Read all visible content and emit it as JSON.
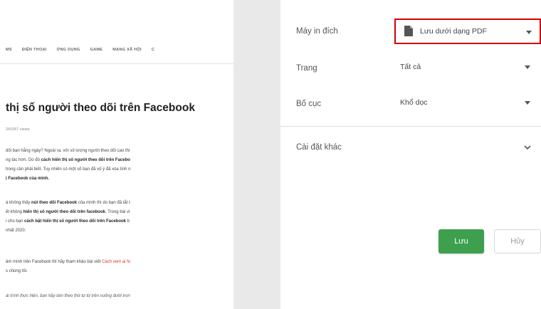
{
  "preview": {
    "nav": [
      "MS",
      "ĐIỆN THOẠI",
      "ỨNG DỤNG",
      "GAME",
      "MẠNG XÃ HỘI",
      "C"
    ],
    "title": "thị số người theo dõi trên Facebook",
    "views": "241067 views",
    "p1": [
      "dõi bạn hằng ngày? Ngoài ra, với số lượng người theo dõi cao thì",
      [
        "ng tác hơn. Do đó ",
        "cách hiển thị số người theo dõi trên Facebo"
      ],
      "trong cần phải biết. Tuy nhiên có một số bạn đã vô ý đã xóa tính n",
      "ị Facebook của mình."
    ],
    "p2": [
      [
        "à không thấy ",
        "nút theo dõi Facebook",
        " của mình thì do bạn đã tắt t"
      ],
      [
        "ết không ",
        "hiển thị số người theo dõi trên facebook",
        ". Trong bài vi"
      ],
      [
        "i cho bạn ",
        "cách bật hiển thị số người theo dõi trên Facebook",
        " b"
      ],
      "nhất 2020."
    ],
    "p3": [
      [
        "âm mình trên Facebook thì hãy tham khảo bài viết ",
        "Cách xem ai fo"
      ],
      "s chúng tôi."
    ],
    "p4": "ái trình thực hiện, bạn hãy làm theo thứ tự từ trên xuống dưới tron"
  },
  "panel": {
    "dest_label": "Máy in đích",
    "dest_value": "Lưu dưới dạng PDF",
    "pages_label": "Trang",
    "pages_value": "Tất cả",
    "layout_label": "Bố cục",
    "layout_value": "Khổ dọc",
    "more_label": "Cài đặt khác",
    "save_label": "Lưu",
    "cancel_label": "Hủy"
  },
  "colors": {
    "accent": "#3ea04f",
    "highlight": "#d10000"
  },
  "icons": {
    "dest": "pdf-file-icon",
    "dropdown": "caret-down-icon",
    "more": "chevron-down-icon"
  }
}
